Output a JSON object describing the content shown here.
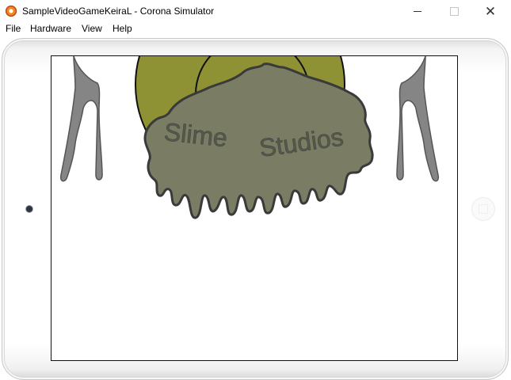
{
  "window": {
    "title": "SampleVideoGameKeiraL - Corona Simulator",
    "minimize_symbol": "",
    "close_symbol": "✕"
  },
  "menu": {
    "items": [
      "File",
      "Hardware",
      "View",
      "Help"
    ]
  },
  "game": {
    "logo_word_1": "Slime",
    "logo_word_2": "Studios",
    "colors": {
      "slime": "#7a7d64",
      "sun": "#8e9234",
      "spoon": "#858585",
      "outline": "#3a3a3a"
    }
  },
  "icons": {
    "app": "corona-icon",
    "camera": "camera-icon",
    "home": "home-button-icon"
  }
}
